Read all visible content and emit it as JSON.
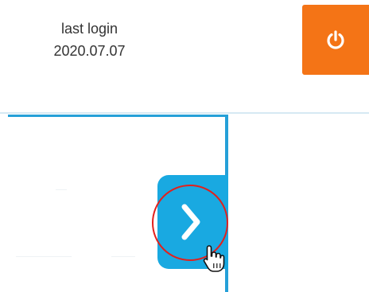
{
  "header": {
    "last_login_label": "last login",
    "last_login_date": "2020.07.07",
    "power_icon": "power-icon",
    "power_color": "#f47416"
  },
  "panel": {
    "accent_color": "#25a0d8",
    "toggle_icon": "chevron-right-icon",
    "toggle_color": "#19a9e1",
    "highlight_color": "#e2201c"
  }
}
